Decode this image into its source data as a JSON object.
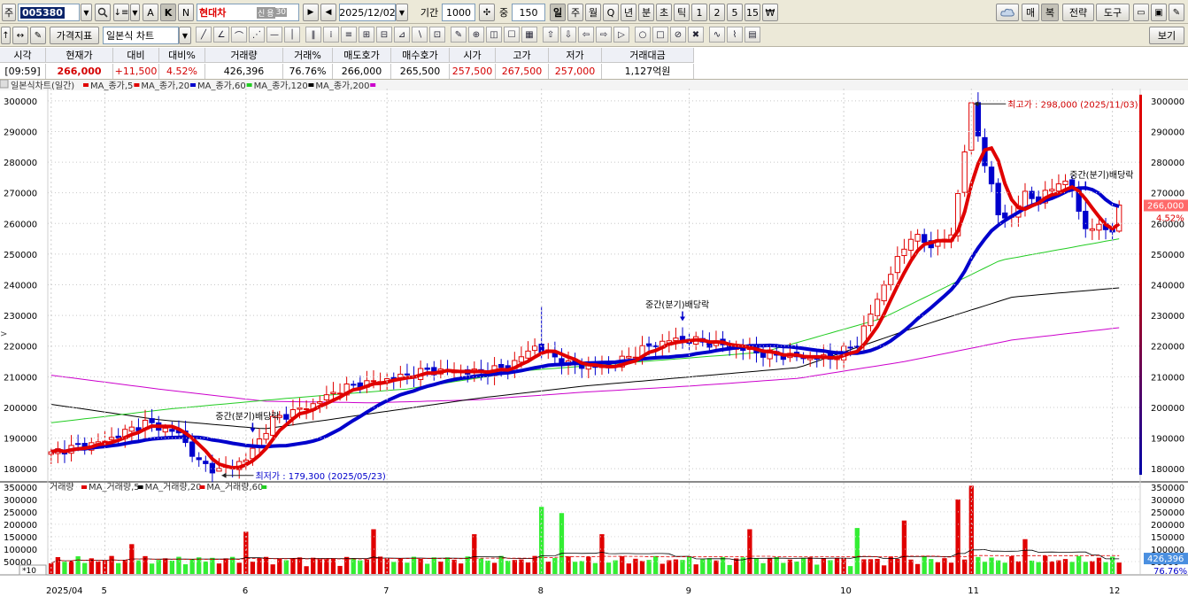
{
  "toolbar1": {
    "prefix_label": "주",
    "code_value": "005380",
    "name_value": "현대차",
    "name_badges": [
      "신",
      "용",
      "30"
    ],
    "letter_buttons": [
      "A",
      "K",
      "N"
    ],
    "date_value": "2025/12/02",
    "period_label": "기간",
    "period_value": "1000",
    "zoom_label": "중",
    "zoom_value": "150",
    "period_tabs": [
      "일",
      "주",
      "월",
      "Q",
      "년",
      "분",
      "초",
      "틱",
      "1",
      "2",
      "5",
      "15",
      "₩"
    ],
    "active_tab": "일",
    "right_buttons": [
      "매",
      "복",
      "전략",
      "도구"
    ]
  },
  "toolbar2": {
    "indicator_label": "가격지표",
    "charttype_value": "일본식 차트",
    "view_label": "보기"
  },
  "quote": {
    "headers": [
      "시각",
      "현재가",
      "대비",
      "대비%",
      "거래량",
      "거래%",
      "매도호가",
      "매수호가",
      "시가",
      "고가",
      "저가",
      "거래대금"
    ],
    "values": [
      "[09:59]",
      "266,000",
      "+11,500",
      "4.52%",
      "426,396",
      "76.76%",
      "266,000",
      "265,500",
      "257,500",
      "267,500",
      "257,000",
      "1,127억원"
    ]
  },
  "chart_data": [
    {
      "type": "candlestick",
      "title": "일본식차트(일간)",
      "legend": [
        {
          "name": "MA_종가,5",
          "color": "#e00000"
        },
        {
          "name": "MA_종가,20",
          "color": "#e00000"
        },
        {
          "name": "MA_종가,60",
          "color": "#0000cc"
        },
        {
          "name": "MA_종가,120",
          "color": "#22cc22"
        },
        {
          "name": "MA_종가,200",
          "color": "#000000"
        },
        {
          "name": "",
          "color": "#cc00cc"
        }
      ],
      "ylim": [
        176000,
        304000
      ],
      "yticks": [
        180000,
        190000,
        200000,
        210000,
        220000,
        230000,
        240000,
        250000,
        260000,
        270000,
        280000,
        290000,
        300000
      ],
      "ytick_labels": [
        "180000",
        "190000",
        "200000",
        "210000",
        "220000",
        "230000",
        "240000",
        "250000",
        "260000",
        "270000",
        "280000",
        "290000",
        "300000"
      ],
      "x_labels": [
        {
          "i": 0,
          "label": "2025/04"
        },
        {
          "i": 8,
          "label": "5"
        },
        {
          "i": 29,
          "label": "6"
        },
        {
          "i": 50,
          "label": "7"
        },
        {
          "i": 73,
          "label": "8"
        },
        {
          "i": 95,
          "label": "9"
        },
        {
          "i": 118,
          "label": "10"
        },
        {
          "i": 137,
          "label": "11"
        },
        {
          "i": 158,
          "label": "12"
        }
      ],
      "n_days": 160,
      "keypoints": [
        [
          0,
          185500
        ],
        [
          8,
          189000
        ],
        [
          14,
          195000
        ],
        [
          19,
          191500
        ],
        [
          22,
          182000
        ],
        [
          25,
          179300
        ],
        [
          29,
          183000
        ],
        [
          33,
          196000
        ],
        [
          39,
          201000
        ],
        [
          43,
          206000
        ],
        [
          47,
          208000
        ],
        [
          52,
          210000
        ],
        [
          56,
          212000
        ],
        [
          63,
          211500
        ],
        [
          68,
          213000
        ],
        [
          72,
          220000
        ],
        [
          77,
          214000
        ],
        [
          83,
          213000
        ],
        [
          88,
          219000
        ],
        [
          92,
          222000
        ],
        [
          95,
          222000
        ],
        [
          101,
          220000
        ],
        [
          106,
          217500
        ],
        [
          111,
          216500
        ],
        [
          116,
          216000
        ],
        [
          120,
          221000
        ],
        [
          124,
          240000
        ],
        [
          128,
          256000
        ],
        [
          131,
          253000
        ],
        [
          134,
          256000
        ],
        [
          137,
          298000
        ],
        [
          139,
          280000
        ],
        [
          141,
          263000
        ],
        [
          143,
          262000
        ],
        [
          145,
          270000
        ],
        [
          147,
          267000
        ],
        [
          150,
          274000
        ],
        [
          152,
          271000
        ],
        [
          154,
          258000
        ],
        [
          156,
          259000
        ],
        [
          158,
          258000
        ],
        [
          159,
          266000
        ]
      ],
      "volume_spikes": [
        [
          12,
          120000
        ],
        [
          29,
          170000
        ],
        [
          48,
          180000
        ],
        [
          63,
          160000
        ],
        [
          73,
          270000
        ],
        [
          76,
          245000
        ],
        [
          82,
          160000
        ],
        [
          104,
          180000
        ],
        [
          120,
          185000
        ],
        [
          127,
          215000
        ],
        [
          135,
          300000
        ],
        [
          137,
          355000
        ],
        [
          145,
          140000
        ]
      ],
      "current_value_label": "266,000",
      "current_change_label": "4.52%",
      "annotations": [
        {
          "i": 137,
          "text": "최고가 : 298,000 (2025/11/03)",
          "color": "#d00000",
          "arrow": "left"
        },
        {
          "i": 25,
          "text": "최저가 : 179,300 (2025/05/23)",
          "color": "#0000cc",
          "arrow": "left"
        },
        {
          "i": 30,
          "text": "중간(분기)배당락",
          "color": "#000000",
          "arrow": "down"
        },
        {
          "i": 94,
          "text": "중간(분기)배당락",
          "color": "#000000",
          "arrow": "down"
        },
        {
          "i": 154,
          "text": "중간(분기)배당락",
          "color": "#000000",
          "arrow": "down"
        }
      ]
    },
    {
      "type": "bar",
      "title": "거래량",
      "legend": [
        {
          "name": "MA_거래량,5",
          "color": "#e00000"
        },
        {
          "name": "MA_거래량,20",
          "color": "#000000"
        },
        {
          "name": "MA_거래량,60",
          "color": "#e00000"
        },
        {
          "name": "",
          "color": "#22cc22"
        }
      ],
      "ylim": [
        0,
        360000
      ],
      "yticks": [
        50000,
        100000,
        150000,
        200000,
        250000,
        300000,
        350000
      ],
      "ytick_labels": [
        "50000",
        "100000",
        "150000",
        "200000",
        "250000",
        "300000",
        "350000"
      ],
      "unit_label": "*10",
      "current_value_label": "426,396",
      "current_ratio_label": "76.76%"
    }
  ]
}
